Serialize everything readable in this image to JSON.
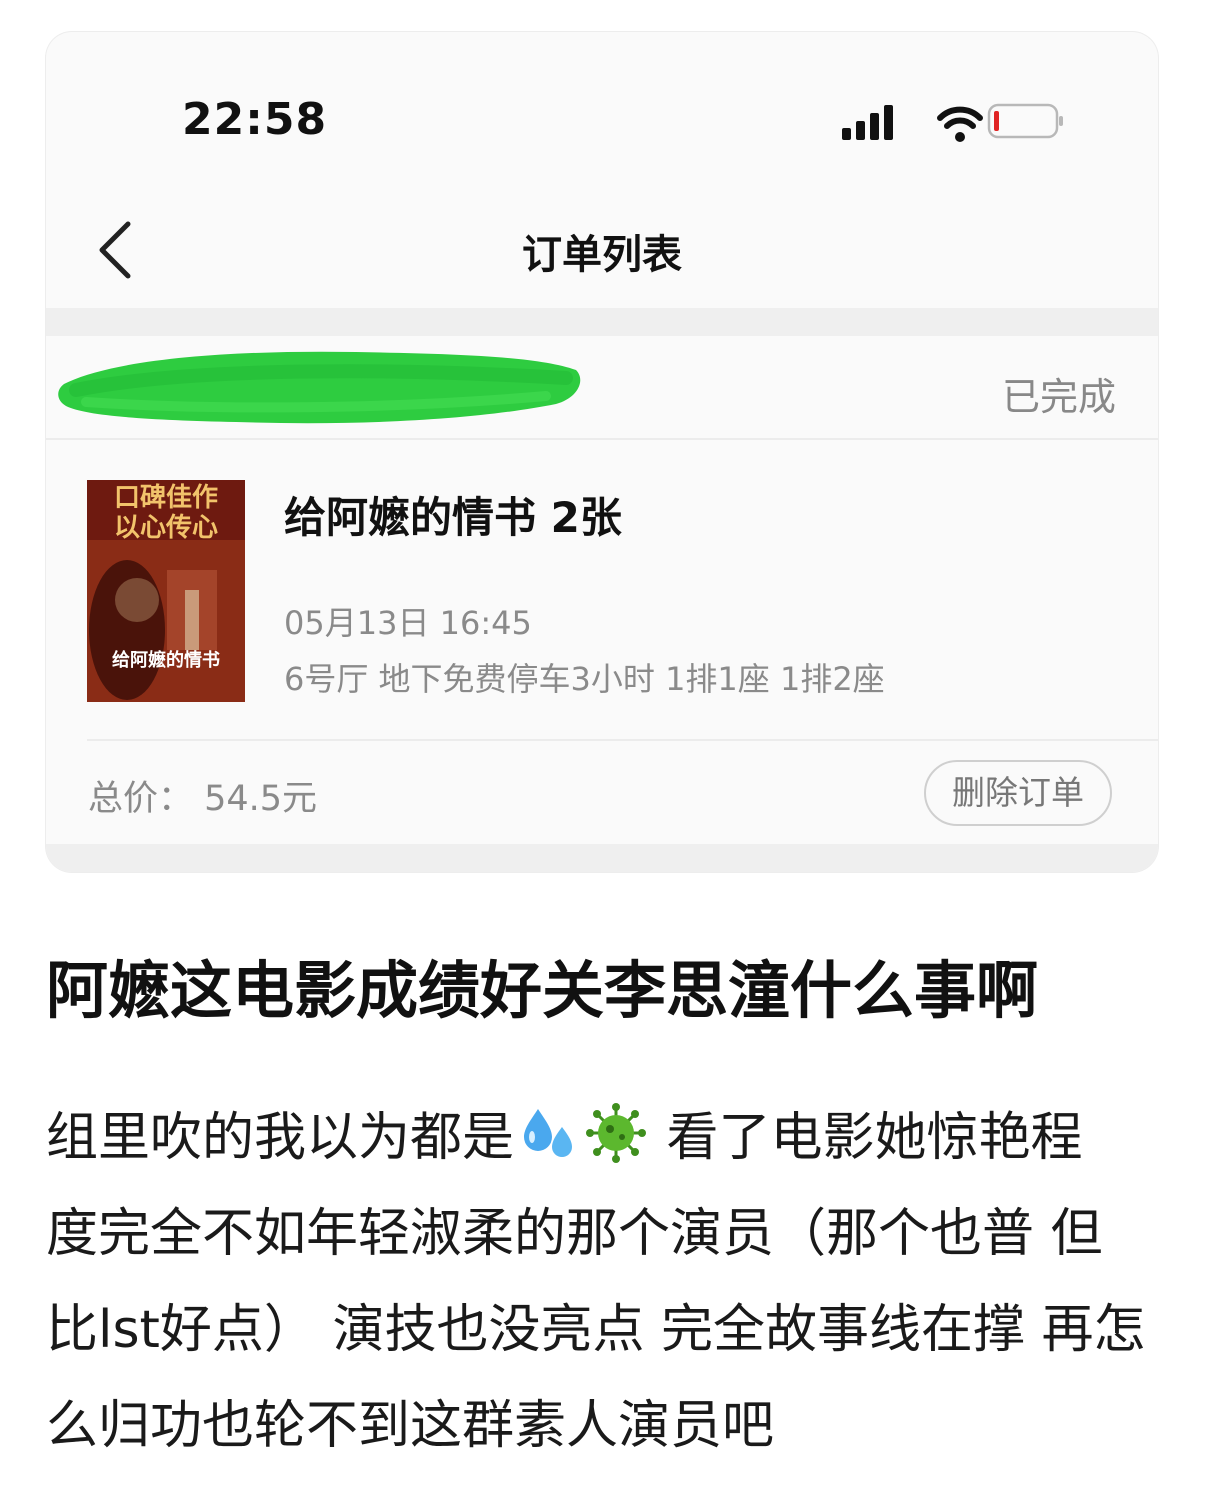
{
  "status_bar": {
    "time": "22:58"
  },
  "navbar": {
    "title": "订单列表"
  },
  "order": {
    "status": "已完成",
    "poster": {
      "top_text_1": "口碑佳作",
      "top_text_2": "以心传心",
      "title_text": "给阿嬷的情书"
    },
    "movie_title": "给阿嬷的情书 2张",
    "datetime": "05月13日 16:45",
    "details": "6号厅 地下免费停车3小时 1排1座 1排2座",
    "total": "总价： 54.5元",
    "delete_label": "删除订单"
  },
  "post": {
    "title": "阿嬷这电影成绩好关李思潼什么事啊",
    "line1_before": "组里吹的我以为都是",
    "line1_after": " 看了电影她惊艳程",
    "line2": "度完全不如年轻淑柔的那个演员（那个也普 但",
    "line3": "比lst好点） 演技也没亮点 完全故事线在撑 再怎",
    "line4": "么归功也轮不到这群素人演员吧",
    "emojis": [
      "sweat-droplets-icon",
      "microbe-icon"
    ]
  },
  "colors": {
    "accent_green": "#2ecc40",
    "battery_low": "#e02424",
    "muted_text": "#8a8a8a"
  }
}
